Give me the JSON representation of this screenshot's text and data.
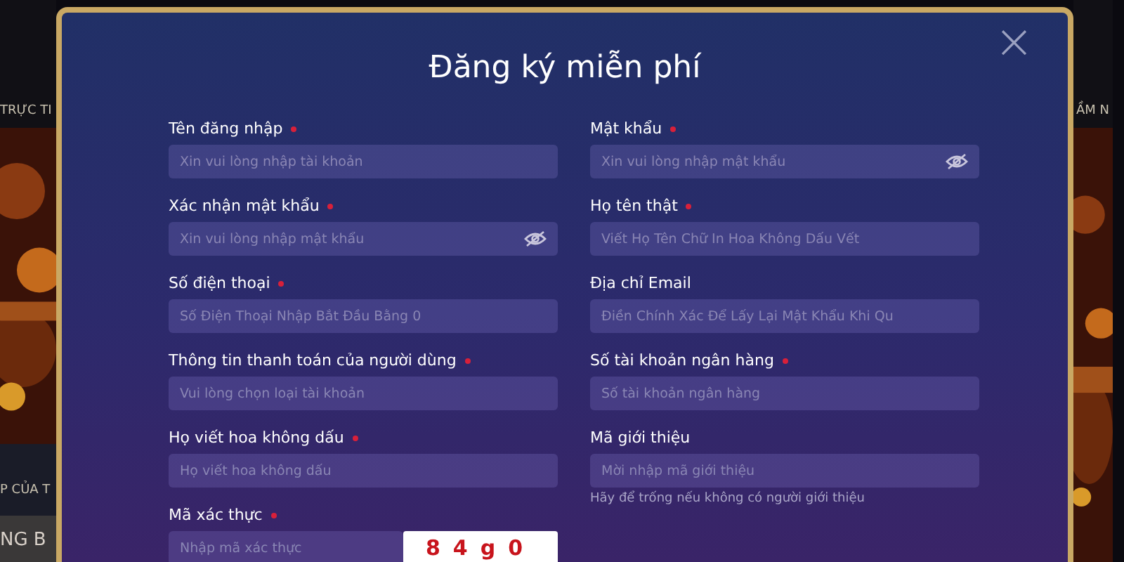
{
  "background": {
    "left_texts": [
      "TRỰC TI",
      "P CỦA T",
      "NG B"
    ],
    "right_texts": [
      "ẦM N"
    ]
  },
  "dialog": {
    "title": "Đăng ký miễn phí",
    "close_icon": "×",
    "fields": [
      {
        "kind": "text",
        "label": "Tên đăng nhập",
        "required": true,
        "placeholder": "Xin vui lòng nhập tài khoản"
      },
      {
        "kind": "password",
        "label": "Mật khẩu",
        "required": true,
        "placeholder": "Xin vui lòng nhập mật khẩu"
      },
      {
        "kind": "password",
        "label": "Xác nhận mật khẩu",
        "required": true,
        "placeholder": "Xin vui lòng nhập mật khẩu"
      },
      {
        "kind": "text",
        "label": "Họ tên thật",
        "required": true,
        "placeholder": "Viết Họ Tên Chữ In Hoa Không Dấu Vết"
      },
      {
        "kind": "text",
        "label": "Số điện thoại",
        "required": true,
        "placeholder": "Số Điện Thoại Nhập Bắt Đầu Bằng 0"
      },
      {
        "kind": "text",
        "label": "Địa chỉ Email",
        "required": false,
        "placeholder": "Điền Chính Xác Để Lấy Lại Mật Khẩu Khi Qu"
      },
      {
        "kind": "text",
        "label": "Thông tin thanh toán của người dùng",
        "required": true,
        "placeholder": "Vui lòng chọn loại tài khoản"
      },
      {
        "kind": "text",
        "label": "Số tài khoản ngân hàng",
        "required": true,
        "placeholder": "Số tài khoản ngân hàng"
      },
      {
        "kind": "text",
        "label": "Họ viết hoa không dấu",
        "required": true,
        "placeholder": "Họ viết hoa không dấu"
      },
      {
        "kind": "text",
        "label": "Mã giới thiệu",
        "required": false,
        "placeholder": "Mời nhập mã giới thiệu",
        "hint": "Hãy để trống nếu không có người giới thiệu"
      },
      {
        "kind": "captcha",
        "label": "Mã xác thực",
        "required": true,
        "placeholder": "Nhập mã xác thực",
        "captcha": "84g0"
      }
    ]
  }
}
